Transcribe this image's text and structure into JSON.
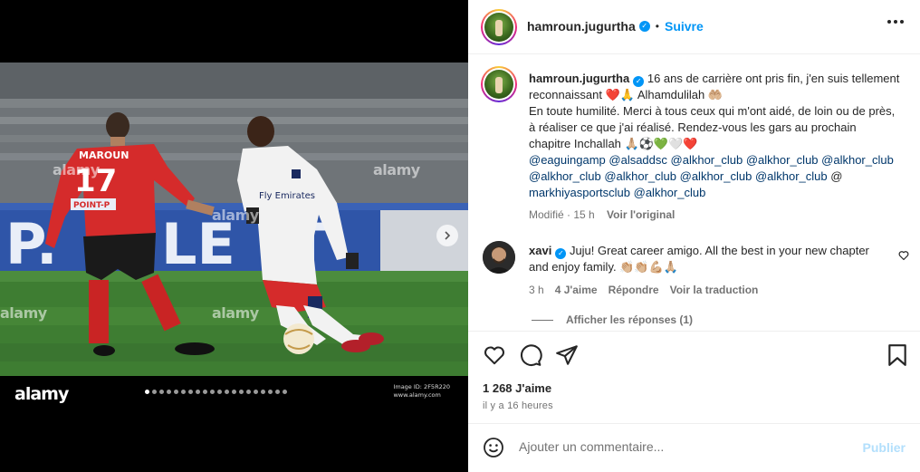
{
  "media": {
    "watermark": "alamy",
    "image_id_label": "Image ID: 2F5R220",
    "image_site": "www.alamy.com",
    "player_name": "MAROUN",
    "player_number": "17",
    "shirt_sponsor": "POINT-P",
    "carousel_count": 20,
    "carousel_active_index": 0,
    "next_icon": "chevron-right-icon"
  },
  "header": {
    "username": "hamroun.jugurtha",
    "separator": "•",
    "follow_label": "Suivre",
    "more_icon": "ellipsis-icon"
  },
  "caption": {
    "username": "hamroun.jugurtha",
    "line1": "16 ans de carrière ont pris fin, j'en suis tellement reconnaissant ❤️🙏 Alhamdulilah 🤲🏼",
    "line2": "En toute humilité. Merci à tous ceux qui m'ont aidé, de loin ou de près, à réaliser ce que j'ai réalisé. Rendez-vous les gars au prochain chapitre Inchallah 🙏🏼⚽️💚🤍❤️",
    "tags": [
      "@eaguingamp",
      "@alsaddsc",
      "@alkhor_club",
      "@alkhor_club",
      "@alkhor_club",
      "@alkhor_club",
      "@alkhor_club",
      "@alkhor_club",
      "@alkhor_club",
      "@",
      "markhiyasportsclub",
      "@alkhor_club"
    ],
    "modified": "Modifié · 15 h",
    "see_original": "Voir l'original"
  },
  "comment": {
    "username": "xavi",
    "text": "Juju! Great career amigo. All the best in your new chapter and enjoy family. 👏🏼👏🏼💪🏼🙏🏼",
    "time": "3 h",
    "likes": "4 J'aime",
    "reply": "Répondre",
    "translate": "Voir la traduction",
    "heart_icon": "heart-outline-icon"
  },
  "replies": {
    "label": "Afficher les réponses (1)"
  },
  "actions": {
    "like_icon": "heart-outline-icon",
    "comment_icon": "comment-bubble-icon",
    "share_icon": "paper-plane-icon",
    "save_icon": "bookmark-icon",
    "likes_count": "1 268 J'aime",
    "posted": "il y a 16 heures"
  },
  "add_comment": {
    "emoji_icon": "smiley-icon",
    "placeholder": "Ajouter un commentaire...",
    "publish_label": "Publier"
  },
  "colors": {
    "accent_blue": "#0095f6",
    "link_blue": "#00376b",
    "muted": "#737373",
    "publish_disabled": "#b2dffc",
    "jersey_red": "#d52b2b",
    "jersey_white": "#f2f2f2"
  }
}
